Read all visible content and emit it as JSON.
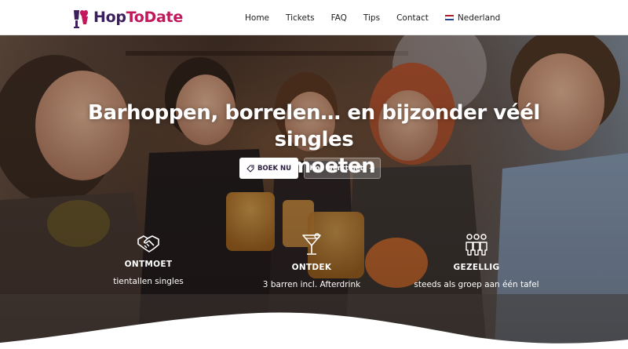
{
  "brand": {
    "part1": "Hop",
    "part2": "ToDate"
  },
  "nav": {
    "items": [
      {
        "label": "Home"
      },
      {
        "label": "Tickets"
      },
      {
        "label": "FAQ"
      },
      {
        "label": "Tips"
      },
      {
        "label": "Contact"
      }
    ],
    "language": "Nederland"
  },
  "hero": {
    "title_line1": "Barhoppen, borrelen… en bijzonder véél singles",
    "title_line2": "ontmoeten",
    "primary_button": "BOEK NU",
    "secondary_button": "Hoe werkt het? →"
  },
  "features": [
    {
      "icon": "handshake-icon",
      "title": "ONTMOET",
      "subtitle": "tientallen singles"
    },
    {
      "icon": "cocktail-icon",
      "title": "ONTDEK",
      "subtitle": "3 barren incl. Afterdrink"
    },
    {
      "icon": "group-icon",
      "title": "GEZELLIG",
      "subtitle": "steeds als groep aan één tafel"
    }
  ],
  "colors": {
    "brand_dark": "#3d1e5c",
    "brand_pink": "#c2185b",
    "flag_red": "#ae1c28",
    "flag_white": "#ffffff",
    "flag_blue": "#21468b"
  }
}
